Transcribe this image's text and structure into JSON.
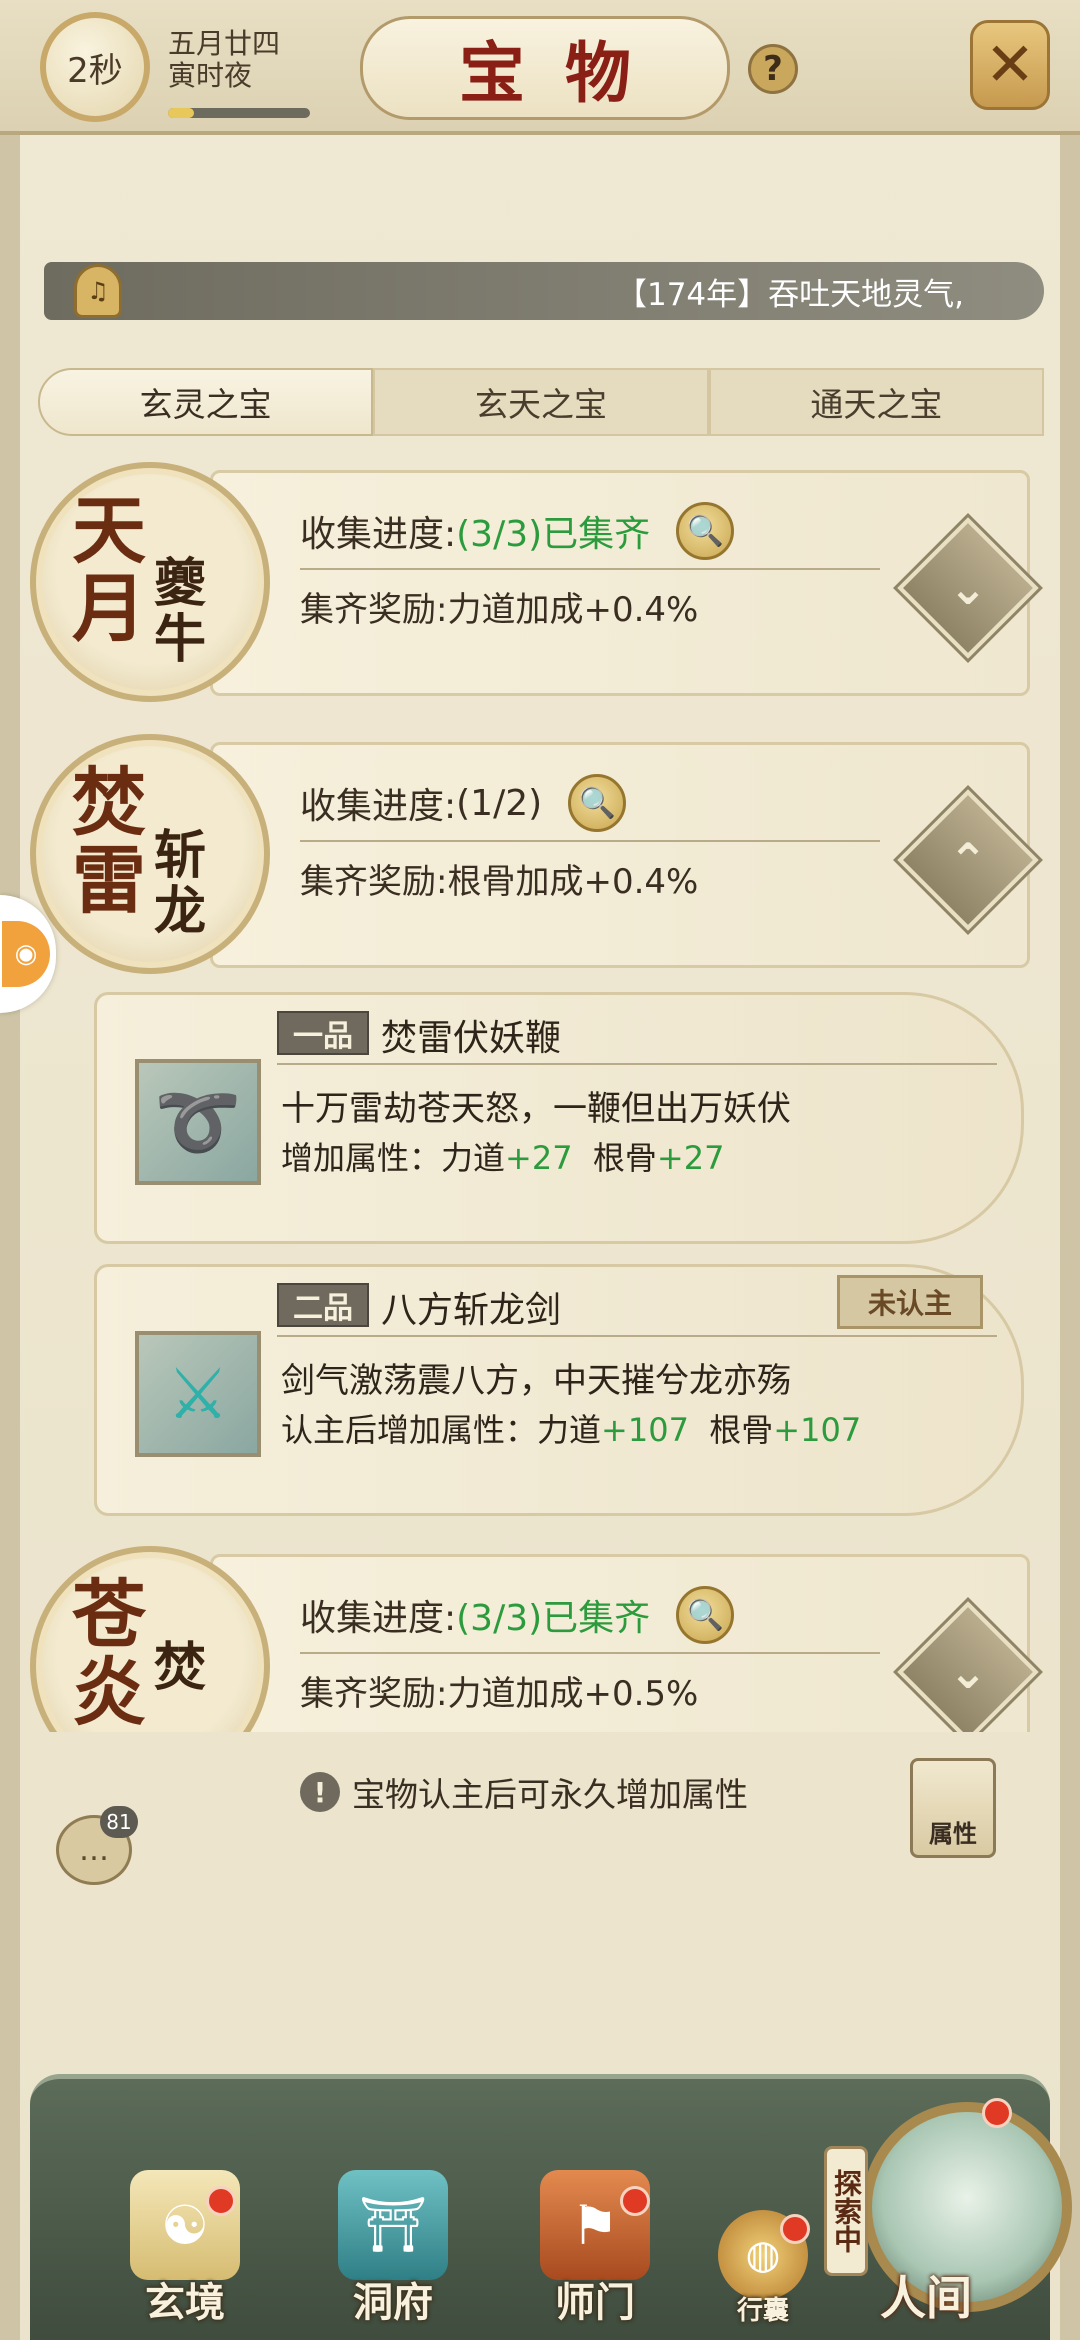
{
  "header": {
    "timer": "2秒",
    "date_line1": "五月廿四",
    "date_line2": "寅时夜",
    "day_progress": 0.18,
    "title": "宝物",
    "help_icon": "question-icon",
    "close_icon": "close-swords-icon"
  },
  "notice": {
    "text": "【174年】吞吐天地灵气,"
  },
  "tabs": [
    {
      "label": "玄灵之宝",
      "active": true
    },
    {
      "label": "玄天之宝",
      "active": false
    },
    {
      "label": "通天之宝",
      "active": false
    }
  ],
  "sets": [
    {
      "medal_big": "天月",
      "medal_small": "夔牛",
      "progress_label": "收集进度:",
      "progress_value": "(3/3)已集齐",
      "complete": true,
      "reward_label": "集齐奖励:",
      "reward_value": "力道加成+0.4%",
      "expanded": false
    },
    {
      "medal_big": "焚雷",
      "medal_small": "斩龙",
      "progress_label": "收集进度:",
      "progress_value": "(1/2)",
      "complete": false,
      "reward_label": "集齐奖励:",
      "reward_value": "根骨加成+0.4%",
      "expanded": true
    },
    {
      "medal_big": "苍炎",
      "medal_small": "焚",
      "progress_label": "收集进度:",
      "progress_value": "(3/3)已集齐",
      "complete": true,
      "reward_label": "集齐奖励:",
      "reward_value": "力道加成+0.5%",
      "expanded": false
    }
  ],
  "items": [
    {
      "grade": "一品",
      "name": "焚雷伏妖鞭",
      "desc": "十万雷劫苍天怒，一鞭但出万妖伏",
      "attr_label": "增加属性：",
      "attr1_name": "力道",
      "attr1_value": "+27",
      "attr2_name": "根骨",
      "attr2_value": "+27",
      "status": ""
    },
    {
      "grade": "二品",
      "name": "八方斩龙剑",
      "desc": "剑气激荡震八方，中天摧兮龙亦殇",
      "attr_label": "认主后增加属性：",
      "attr1_name": "力道",
      "attr1_value": "+107",
      "attr2_name": "根骨",
      "attr2_value": "+107",
      "status": "未认主"
    }
  ],
  "tip": "宝物认主后可永久增加属性",
  "chat": {
    "count": "81"
  },
  "attr_button": "属性",
  "nav": [
    {
      "label": "玄境",
      "badge": true
    },
    {
      "label": "洞府",
      "badge": false
    },
    {
      "label": "师门",
      "badge": true
    },
    {
      "label": "行囊",
      "badge": true
    }
  ],
  "world": {
    "tag": "探索中",
    "label": "人间",
    "badge": true
  },
  "colors": {
    "accent_red": "#8a1f16",
    "complete_green": "#2c9b3d",
    "nav_green": "#4f5f4c"
  }
}
